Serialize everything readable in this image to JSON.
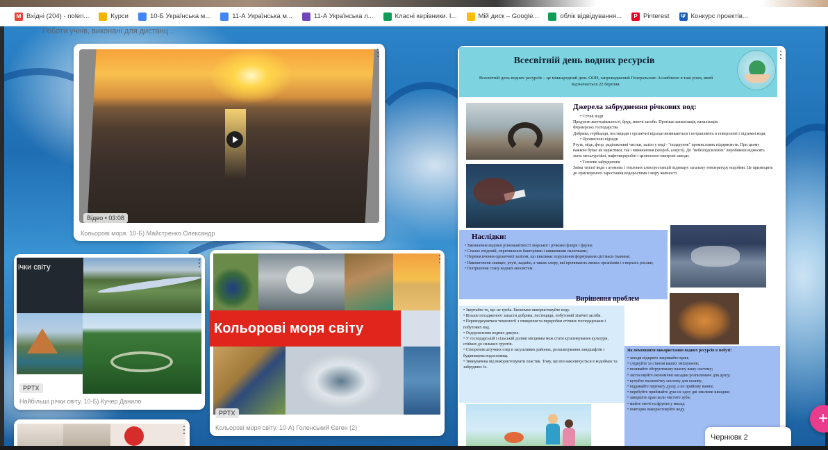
{
  "bookmarks": [
    {
      "label": "Вхідні (204) - nolen...",
      "icon": "gmail-icon",
      "color": "#ea4335",
      "glyph": "M"
    },
    {
      "label": "Курси",
      "icon": "classroom-icon",
      "color": "#f4b400",
      "glyph": ""
    },
    {
      "label": "10-Б Українська м...",
      "icon": "doc-icon",
      "color": "#4285f4",
      "glyph": ""
    },
    {
      "label": "11-А Українська м...",
      "icon": "doc-icon",
      "color": "#4285f4",
      "glyph": ""
    },
    {
      "label": "11-А Українська л...",
      "icon": "form-icon",
      "color": "#7248b9",
      "glyph": ""
    },
    {
      "label": "Класні керівники. I...",
      "icon": "sheet-icon",
      "color": "#0f9d58",
      "glyph": ""
    },
    {
      "label": "Мій диск – Google...",
      "icon": "drive-icon",
      "color": "#fbbc04",
      "glyph": ""
    },
    {
      "label": "облік відвідування...",
      "icon": "sheet-icon",
      "color": "#0f9d58",
      "glyph": ""
    },
    {
      "label": "Pinterest",
      "icon": "pinterest-icon",
      "color": "#e60023",
      "glyph": "P"
    },
    {
      "label": "Конкурс проектів...",
      "icon": "trident-icon",
      "color": "#1c5fb8",
      "glyph": "Ψ"
    }
  ],
  "canvas": {
    "subtitle": "Роботи учнів, виконані для дистанц..."
  },
  "cards": {
    "video": {
      "duration_label": "Відео • 03:08",
      "caption": "Кольорові моря. 10-Б) Майстренко Олександр"
    },
    "rivers": {
      "overlay_title": "ічки світу",
      "type_label": "PPTX",
      "caption": "Найбільші річки світу. 10-Б) Кучер Данило"
    },
    "seas": {
      "banner_title": "Кольорові моря світу",
      "type_label": "PPTX",
      "caption": "Кольорові моря світу. 10-А) Голенський Євген (2)"
    }
  },
  "poster": {
    "title": "Всесвітній день водних ресурсів",
    "intro": "Всесвітній день водних ресурсів – це міжнародний день ООН, запроваджений Генеральною Асамблеєю в такі роки, який відзначається 22 березня.",
    "pollution_heading": "Джерела забруднення річкових вод:",
    "pollution_items": [
      "• Стічні води",
      "Продукти життєдіяльності, бруд, миючі засоби. Протікає каналізація, каналізація.",
      "Фермерські господарства",
      "Добрива, гербіциди, пестициди і органічні відходи вимиваються і потрапляють в поверхневі і підземні води.",
      "• Промислові відходи",
      "Ртуть, мідь, фтор, радіоактивні частки, залізо у воді - \"подарунок\" промислових підприємств. При цьому важкою буває як наркотики, так і виникнення (хвороб, алергії). До \"небезпідсилених\" виробників відносять легкі металургійні, нафтопереробні і целюлозно-паперові заводи.",
      "• Теплове забруднення",
      "Зміна теплої води з атомних і теплових електростанцій підвищує загальну температуру водойми. Це призводить до прискореного заростання водоростями і мору живності."
    ],
    "consequences_heading": "Наслідки:",
    "consequences_items": [
      "• Зменшення видової різноманітності морської і річкової флори і фауни;",
      "• Спалах епідемій, спричинених бактеріями і кишковими паличками;",
      "• Перенасичення органічної залізом, що викликає порушення формування цієї маси тканини;",
      "• Накопичення свинцю, ртуті, кадмію, а також хлору, які проникають живих організмів і з верхніх рослин;",
      "• Погіршення стану водних екосистем."
    ],
    "solutions_heading": "Вирішення проблем",
    "solutions_left": [
      "• Звертайте те, що не треба. Економно використовуйте воду.",
      "• Більше посадженого запасти добрива, пестициди, побутовий хімічні засоби.",
      "• Переводжуватися технології з очищення та переробки стічних господарських і побутових вод.",
      "• Оздоровлення водних джерел.",
      "• У господарській і сільській долині місцевим меж стати культивування культури, стійких до сильних грунтів.",
      "• Створення штучних озер в засушливих районах, розшляхування ландшафтів і будівництва водосховищ.",
      "• Звинувачена від використовувати пластик. Тому, що він накопичується в водоймах та забруднює їх."
    ],
    "solutions_right_heading": "Як поменшити використання водних ресурсів в побуті:",
    "solutions_right": [
      "• заходи відкрито закривайте кран;",
      "• слідкуйте за станом ваших змішувачів;",
      "• поливайте обгрунтовану власну вашу систему;",
      "• застосовуйте економічні насадки розпилювачі для душу;",
      "• купуйте економічну систему для поливу;",
      "• віддавайте перевагу душу, а не прийому ванни;",
      "• перебуйте приймайте душ не одну дві хвилини швидше;",
      "• завершіть кран коли чистите зуби;",
      "• мийте овочі та фрукти у мисці;",
      "• повторно використовуйте воду."
    ]
  },
  "draft_tab": {
    "label": "Чернювк 2"
  },
  "fab": {
    "label": "+"
  }
}
